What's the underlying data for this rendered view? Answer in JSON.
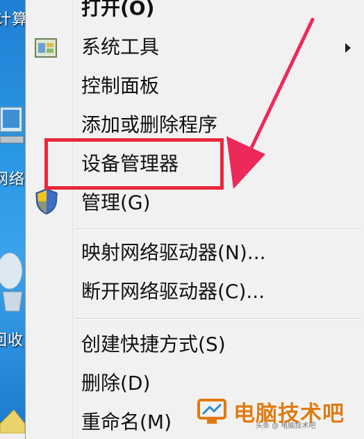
{
  "desktop": {
    "labels": [
      "计算",
      "网络",
      "回收"
    ],
    "icons": [
      "computer-icon",
      "network-icon",
      "recycle-bin-icon"
    ]
  },
  "menu": {
    "items": [
      {
        "label": "打开(O)",
        "icon": "",
        "submenu": false
      },
      {
        "label": "系统工具",
        "icon": "system-tools-icon",
        "submenu": true
      },
      {
        "label": "控制面板",
        "icon": "",
        "submenu": false
      },
      {
        "label": "添加或删除程序",
        "icon": "",
        "submenu": false
      },
      {
        "label": "设备管理器",
        "icon": "",
        "submenu": false,
        "highlighted": true
      },
      {
        "label": "管理(G)",
        "icon": "shield-icon",
        "submenu": false
      },
      {
        "label": "映射网络驱动器(N)...",
        "icon": "",
        "submenu": false
      },
      {
        "label": "断开网络驱动器(C)...",
        "icon": "",
        "submenu": false
      },
      {
        "label": "创建快捷方式(S)",
        "icon": "",
        "submenu": false
      },
      {
        "label": "删除(D)",
        "icon": "",
        "submenu": false
      },
      {
        "label": "重命名(M)",
        "icon": "",
        "submenu": false
      }
    ]
  },
  "annotation": {
    "highlight_color": "#e8283a",
    "arrow_color": "#ec2a5a"
  },
  "watermark": {
    "text": "电脑技术吧",
    "subtext": "头条 @ 电脑技术吧",
    "color": "#e07a12"
  }
}
